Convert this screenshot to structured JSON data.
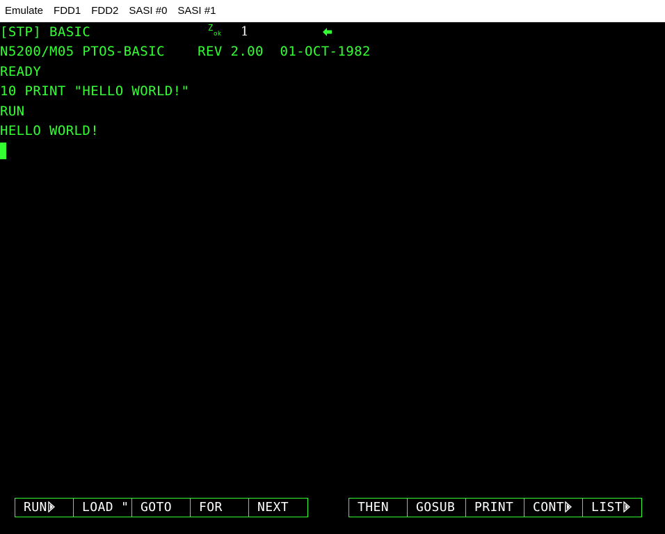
{
  "menu": {
    "items": [
      "Emulate",
      "FDD1",
      "FDD2",
      "SASI #0",
      "SASI #1"
    ]
  },
  "status": {
    "mode": "[STP] BASIC",
    "indicator_z": "Z",
    "indicator_ok": "ok",
    "number": "1",
    "arrow_icon": "left-arrow-icon"
  },
  "terminal": {
    "lines": [
      "N5200/M05 PTOS-BASIC    REV 2.00  01-OCT-1982",
      "READY",
      "10 PRINT \"HELLO WORLD!\"",
      "RUN",
      "HELLO WORLD!"
    ]
  },
  "function_keys": {
    "group1": [
      "RUN",
      "LOAD \"",
      "GOTO",
      "FOR",
      "NEXT"
    ],
    "group1_more": [
      true,
      false,
      false,
      false,
      false
    ],
    "group2": [
      "THEN",
      "GOSUB",
      "PRINT",
      "CONT",
      "LIST"
    ],
    "group2_more": [
      false,
      false,
      false,
      true,
      true
    ]
  },
  "colors": {
    "text": "#33ff33",
    "background": "#000000",
    "key_text": "#ffffff",
    "menubar": "#ffffff"
  }
}
